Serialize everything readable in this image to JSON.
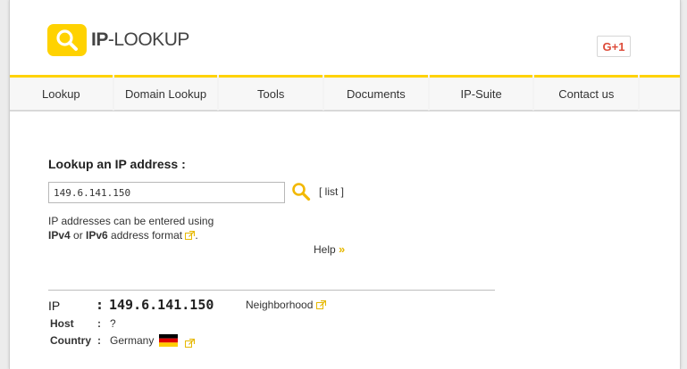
{
  "header": {
    "logo_bold": "IP",
    "logo_rest": "-LOOKUP",
    "gplus_label": "G+1"
  },
  "nav": {
    "items": [
      {
        "label": "Lookup"
      },
      {
        "label": "Domain Lookup"
      },
      {
        "label": "Tools"
      },
      {
        "label": "Documents"
      },
      {
        "label": "IP-Suite"
      },
      {
        "label": "Contact us"
      }
    ]
  },
  "lookup": {
    "title": "Lookup an IP address :",
    "input_value": "149.6.141.150",
    "list_link": "[ list ]",
    "help_line1": "IP addresses can be entered using",
    "ipv4": "IPv4",
    "or": " or ",
    "ipv6": "IPv6",
    "format_text": " address format ",
    "period": ".",
    "help_label": "Help",
    "help_arrow": "»"
  },
  "result": {
    "ip_label": "IP",
    "colon": ":",
    "ip_value": "149.6.141.150",
    "neighborhood": "Neighborhood",
    "host_label": "Host",
    "host_value": "?",
    "country_label": "Country",
    "country_value": "Germany"
  },
  "colors": {
    "accent": "#ffd200",
    "flag_black": "#000000",
    "flag_red": "#dd0000",
    "flag_gold": "#ffce00"
  }
}
